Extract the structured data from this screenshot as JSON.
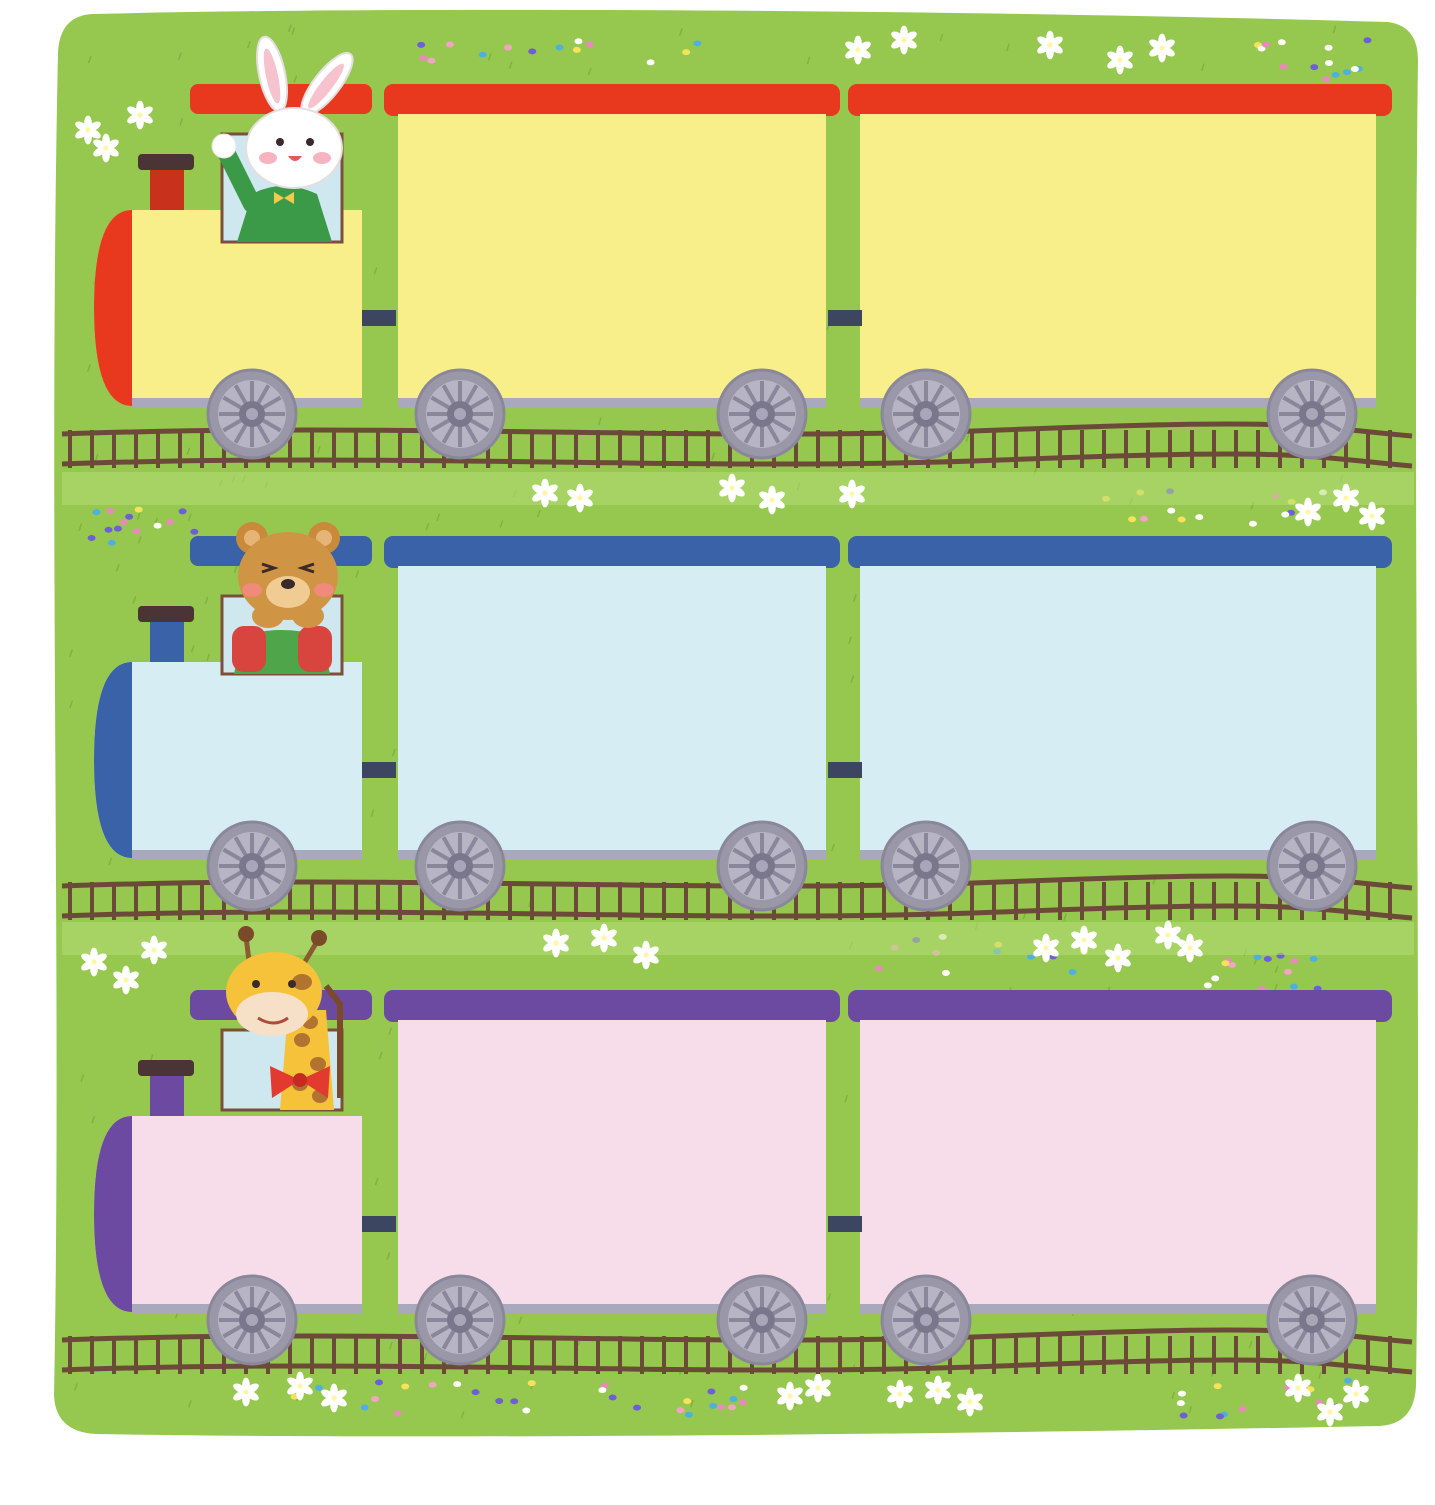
{
  "palette": {
    "grass": "#96c850",
    "grass_dark": "#7fb33f",
    "divider": "#b5dc74",
    "track": "#6b4a38",
    "wheel": "#9a97a8",
    "wheel_hub": "#7a768c",
    "coupler": "#3c4660",
    "window_frame": "#7b4f3a"
  },
  "trains": [
    {
      "theme": "yellow",
      "animal": "rabbit",
      "roof_color": "#e8391e",
      "body_color": "#f8ef8a",
      "chimney_color": "#c8321d",
      "cars": [
        {
          "label": ""
        },
        {
          "label": ""
        }
      ]
    },
    {
      "theme": "blue",
      "animal": "bear",
      "roof_color": "#3a62a8",
      "body_color": "#d6edf3",
      "chimney_color": "#3a62a8",
      "cars": [
        {
          "label": ""
        },
        {
          "label": ""
        }
      ]
    },
    {
      "theme": "pink",
      "animal": "giraffe",
      "roof_color": "#6c4aa2",
      "body_color": "#f7dde9",
      "chimney_color": "#6c4aa2",
      "cars": [
        {
          "label": ""
        },
        {
          "label": ""
        }
      ]
    }
  ]
}
